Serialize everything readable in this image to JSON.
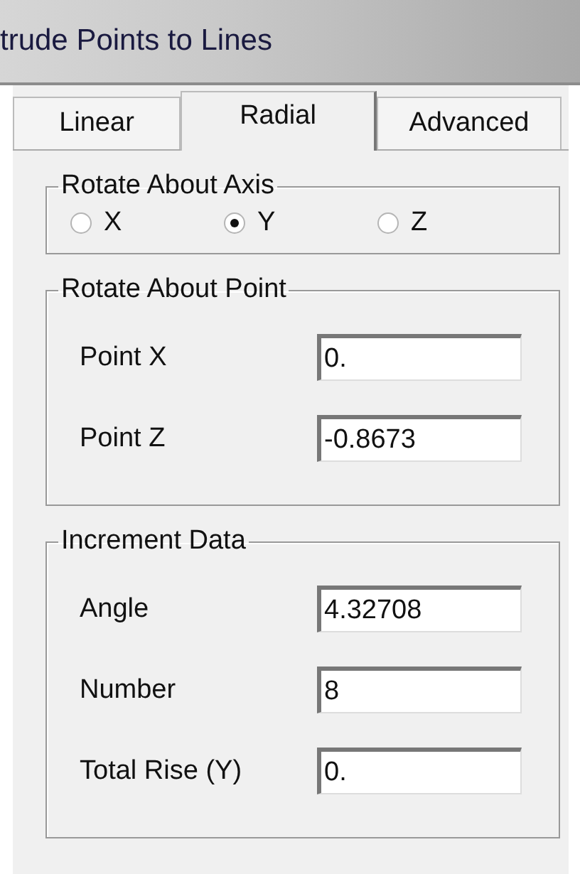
{
  "window": {
    "title": "trude Points to Lines"
  },
  "tabs": [
    {
      "label": "Linear",
      "selected": false
    },
    {
      "label": "Radial",
      "selected": true
    },
    {
      "label": "Advanced",
      "selected": false
    }
  ],
  "groups": [
    {
      "title": "Rotate About Axis",
      "kind": "radios",
      "options": [
        {
          "label": "X",
          "selected": false
        },
        {
          "label": "Y",
          "selected": true
        },
        {
          "label": "Z",
          "selected": false
        }
      ]
    },
    {
      "title": "Rotate About Point",
      "kind": "fields",
      "fields": [
        {
          "label": "Point X",
          "value": "0."
        },
        {
          "label": "Point Z",
          "value": "-0.8673"
        }
      ]
    },
    {
      "title": "Increment Data",
      "kind": "fields",
      "fields": [
        {
          "label": "Angle",
          "value": "4.32708"
        },
        {
          "label": "Number",
          "value": "8"
        },
        {
          "label": "Total Rise (Y)",
          "value": "0."
        }
      ]
    }
  ]
}
